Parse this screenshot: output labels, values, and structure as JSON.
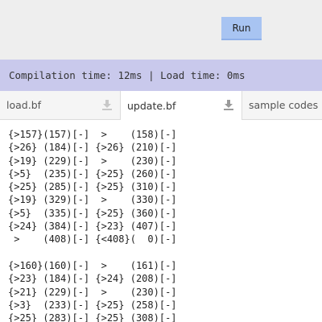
{
  "toolbar": {
    "run_label": "Run"
  },
  "status": {
    "text": "Compilation time: 12ms | Load time: 0ms"
  },
  "tabs": [
    {
      "label": "load.bf",
      "icon": "download-icon",
      "active": false
    },
    {
      "label": "update.bf",
      "icon": "download-icon",
      "active": true
    },
    {
      "label": "sample codes",
      "active": false
    }
  ],
  "editor": {
    "lines": [
      "{>157}(157)[-]  >    (158)[-]",
      "{>26} (184)[-] {>26} (210)[-]",
      "{>19} (229)[-]  >    (230)[-]",
      "{>5}  (235)[-] {>25} (260)[-]",
      "{>25} (285)[-] {>25} (310)[-]",
      "{>19} (329)[-]  >    (330)[-]",
      "{>5}  (335)[-] {>25} (360)[-]",
      "{>24} (384)[-] {>23} (407)[-]",
      " >    (408)[-] {<408}(  0)[-]",
      "",
      "{>160}(160)[-]  >    (161)[-]",
      "{>23} (184)[-] {>24} (208)[-]",
      "{>21} (229)[-]  >    (230)[-]",
      "{>3}  (233)[-] {>25} (258)[-]",
      "{>25} (283)[-] {>25} (308)[-]"
    ]
  }
}
